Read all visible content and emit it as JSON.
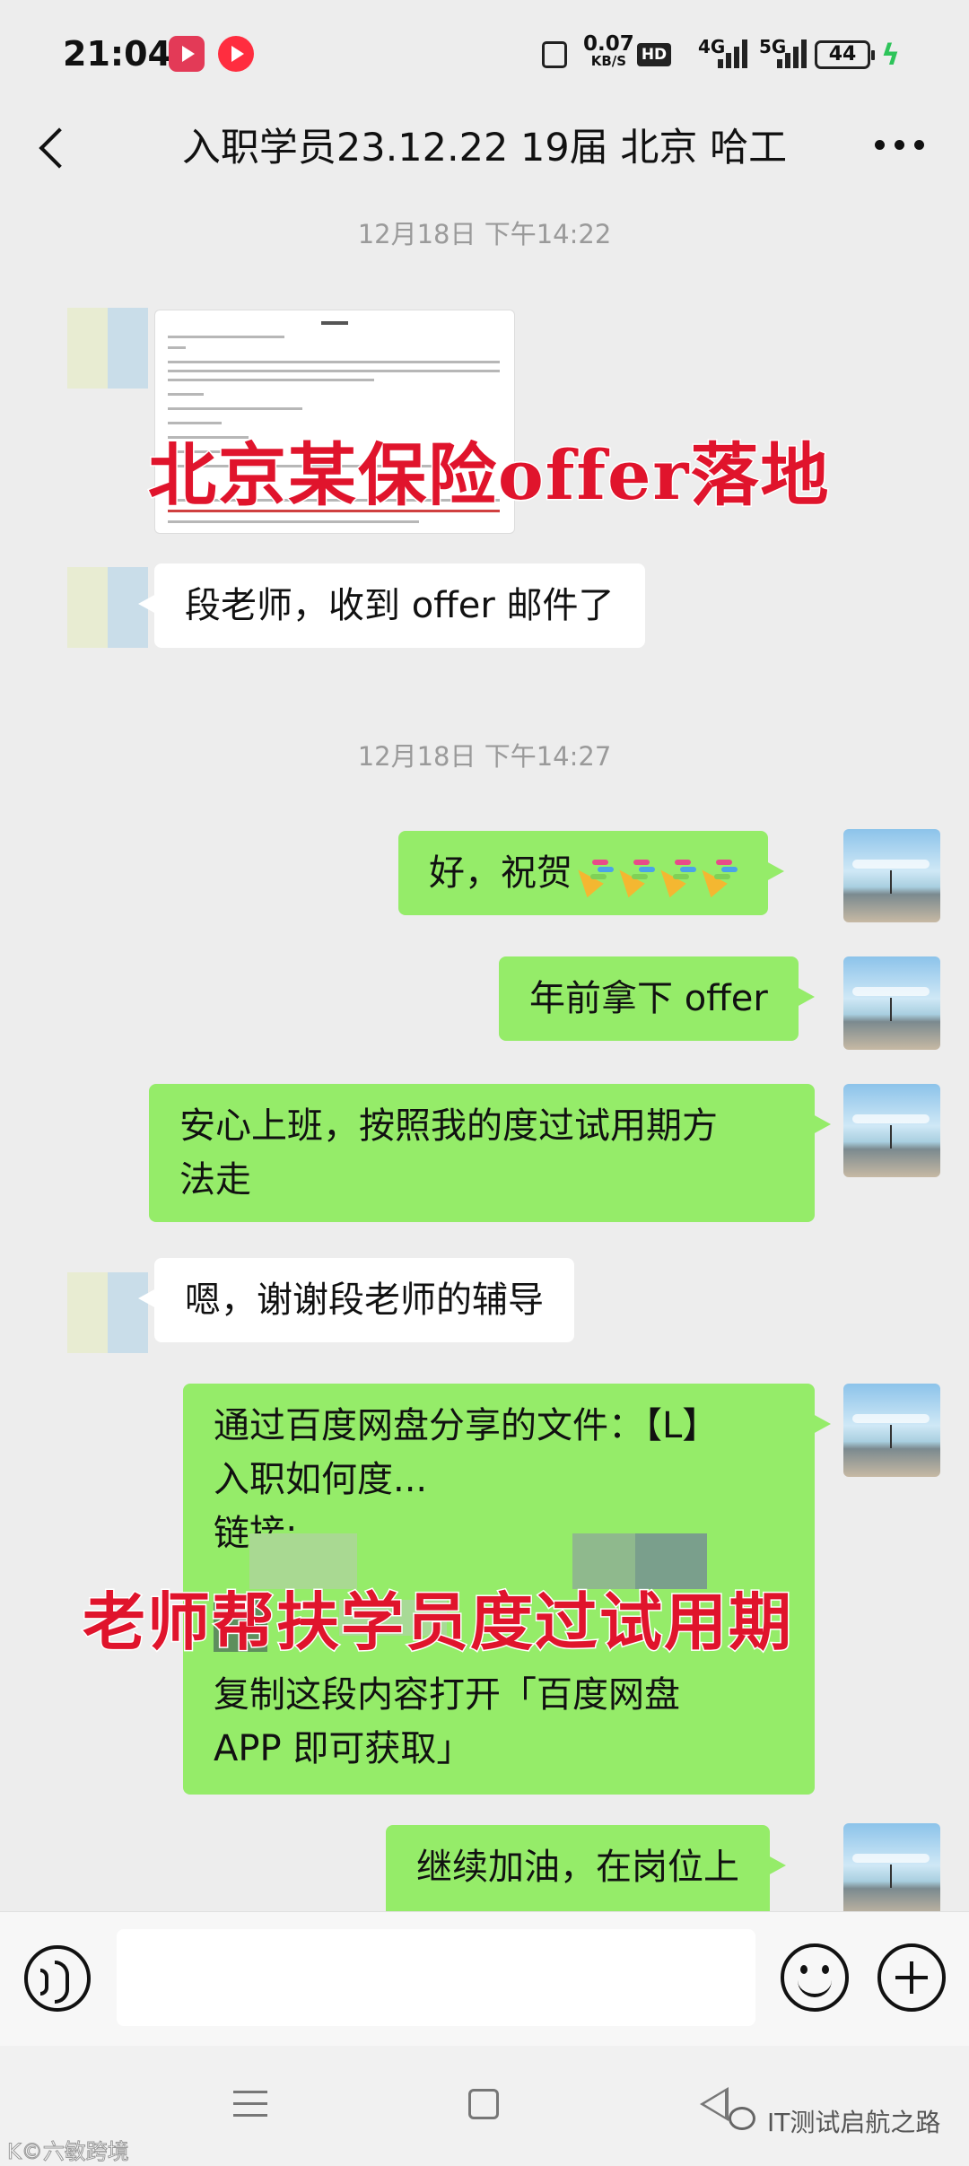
{
  "status_bar": {
    "time": "21:04",
    "net_speed_value": "0.07",
    "net_speed_unit": "KB/S",
    "hd_label": "HD",
    "sim1_label": "4G",
    "sim2_label": "5G",
    "battery": "44"
  },
  "header": {
    "title": "入职学员23.12.22 19届 北京 哈工"
  },
  "messages": [
    {
      "type": "timestamp",
      "text": "12月18日 下午14:22"
    },
    {
      "type": "image",
      "side": "left",
      "caption_overlay": "北京某保险offer落地"
    },
    {
      "type": "text",
      "side": "left",
      "text": "段老师，收到 offer 邮件了"
    },
    {
      "type": "timestamp",
      "text": "12月18日 下午14:27"
    },
    {
      "type": "text",
      "side": "right",
      "text": "好，祝贺"
    },
    {
      "type": "text",
      "side": "right",
      "text": "年前拿下 offer"
    },
    {
      "type": "text",
      "side": "right",
      "line1": "安心上班，按照我的度过试用期方",
      "line2": "法走"
    },
    {
      "type": "text",
      "side": "left",
      "text": "嗯，谢谢段老师的辅导"
    },
    {
      "type": "text",
      "side": "right",
      "line1": "通过百度网盘分享的文件：【L】",
      "line2": "入职如何度...",
      "line3": "链接:",
      "line4": "复制这段内容打开「百度网盘",
      "line5": "APP 即可获取」"
    },
    {
      "type": "text",
      "side": "right",
      "text": "继续加油，在岗位上"
    }
  ],
  "overlay_caption_2": "老师帮扶学员度过试用期",
  "watermarks": {
    "left": "K©六敏跨境",
    "right": "IT测试启航之路"
  },
  "icons": [
    "back-icon",
    "more-icon",
    "voice-icon",
    "emoji-icon",
    "plus-icon",
    "party-popper-icon"
  ]
}
